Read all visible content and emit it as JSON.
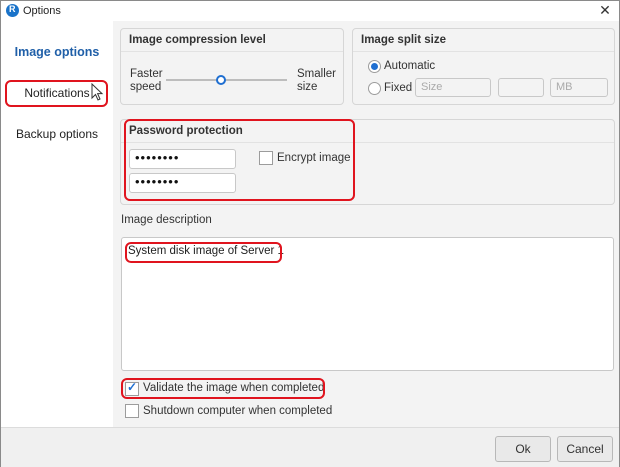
{
  "window": {
    "title": "Options",
    "close_glyph": "✕"
  },
  "sidebar": {
    "items": [
      {
        "label": "Image options",
        "active": true
      },
      {
        "label": "Notifications",
        "active": false
      },
      {
        "label": "Backup options",
        "active": false
      }
    ]
  },
  "compression": {
    "title": "Image compression level",
    "left_label_1": "Faster",
    "left_label_2": "speed",
    "right_label_1": "Smaller",
    "right_label_2": "size",
    "slider_value_fraction": 0.45
  },
  "split": {
    "title": "Image split size",
    "automatic_label": "Automatic",
    "fixed_label": "Fixed",
    "size_placeholder": "Size",
    "unit_placeholder": "MB",
    "selected": "Automatic"
  },
  "password": {
    "title": "Password protection",
    "password_value": "••••••••",
    "confirm_value": "••••••••",
    "encrypt_label": "Encrypt image",
    "encrypt_checked": false
  },
  "description": {
    "label": "Image description",
    "value": "System disk image of Server 1"
  },
  "options": {
    "validate_label": "Validate the image when completed",
    "validate_checked": true,
    "shutdown_label": "Shutdown computer when completed",
    "shutdown_checked": false
  },
  "footer": {
    "ok_label": "Ok",
    "cancel_label": "Cancel"
  },
  "colors": {
    "accent": "#1f6fd1",
    "highlight": "#e0141e",
    "active_nav": "#1f5fa8"
  }
}
